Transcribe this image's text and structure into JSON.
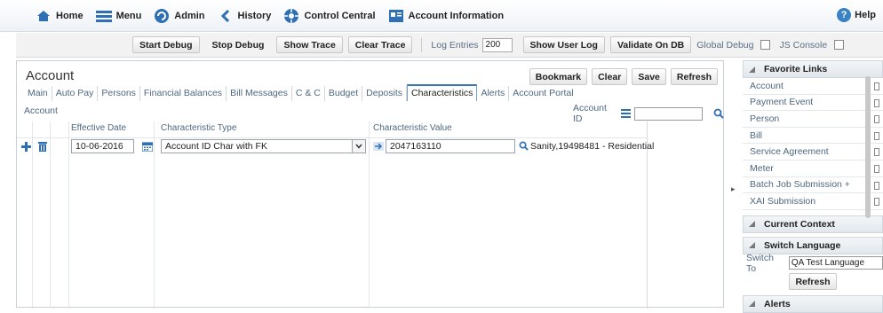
{
  "topnav": {
    "home": "Home",
    "menu": "Menu",
    "admin": "Admin",
    "history": "History",
    "control_central": "Control Central",
    "account_information": "Account Information",
    "help": "Help"
  },
  "debug": {
    "start_debug": "Start Debug",
    "stop_debug": "Stop Debug",
    "show_trace": "Show Trace",
    "clear_trace": "Clear Trace",
    "log_entries_label": "Log Entries",
    "log_entries_value": "200",
    "show_user_log": "Show User Log",
    "validate_on_db": "Validate On DB",
    "global_debug": "Global Debug",
    "js_console": "JS Console"
  },
  "main": {
    "title": "Account",
    "buttons": {
      "bookmark": "Bookmark",
      "clear": "Clear",
      "save": "Save",
      "refresh": "Refresh"
    },
    "tabs": [
      {
        "label": "Main"
      },
      {
        "label": "Auto Pay"
      },
      {
        "label": "Persons"
      },
      {
        "label": "Financial Balances"
      },
      {
        "label": "Bill Messages"
      },
      {
        "label": "C & C"
      },
      {
        "label": "Budget"
      },
      {
        "label": "Deposits"
      },
      {
        "label": "Characteristics"
      },
      {
        "label": "Alerts"
      },
      {
        "label": "Account Portal"
      }
    ],
    "subheader": "Account",
    "account_id_label": "Account ID",
    "account_id_value": ""
  },
  "grid": {
    "headers": {
      "effective_date": "Effective Date",
      "char_type": "Characteristic Type",
      "char_value": "Characteristic Value"
    },
    "row": {
      "effective_date": "10-06-2016",
      "char_type": "Account ID Char with FK",
      "char_value": "2047163110",
      "description": "Sanity,19498481 - Residential"
    }
  },
  "sidebar": {
    "favorite_links": "Favorite Links",
    "links": [
      {
        "label": "Account"
      },
      {
        "label": "Payment Event"
      },
      {
        "label": "Person"
      },
      {
        "label": "Bill"
      },
      {
        "label": "Service Agreement"
      },
      {
        "label": "Meter"
      },
      {
        "label": "Batch Job Submission +"
      },
      {
        "label": "XAI Submission"
      }
    ],
    "current_context": "Current Context",
    "switch_language": "Switch Language",
    "switch_to_label": "Switch To",
    "switch_to_value": "QA Test Language",
    "refresh": "Refresh",
    "alerts": "Alerts"
  },
  "colors": {
    "accent": "#3b82c4",
    "link": "#4f6880",
    "active_tab_border": "#3976b8"
  }
}
